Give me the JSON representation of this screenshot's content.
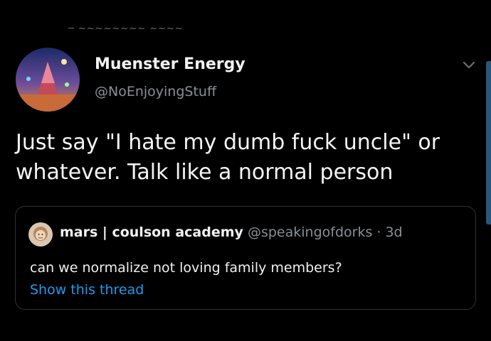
{
  "colors": {
    "background": "#000000",
    "text_primary": "#f4f4f4",
    "text_secondary": "#8a8f94",
    "link": "#1d9bf0",
    "card_border": "#2f3336",
    "scrollbar": "#2a5678"
  },
  "tweet": {
    "display_name": "Muenster Energy",
    "handle": "@NoEnjoyingStuff",
    "text": "Just say \"I hate my dumb fuck uncle\" or whatever. Talk like a normal person",
    "menu_icon": "chevron-down-icon"
  },
  "quoted_tweet": {
    "display_name": "mars | coulson academy",
    "handle_time": "@speakingofdorks · 3d",
    "text": "can we normalize not loving family members?",
    "link": "Show this thread"
  }
}
